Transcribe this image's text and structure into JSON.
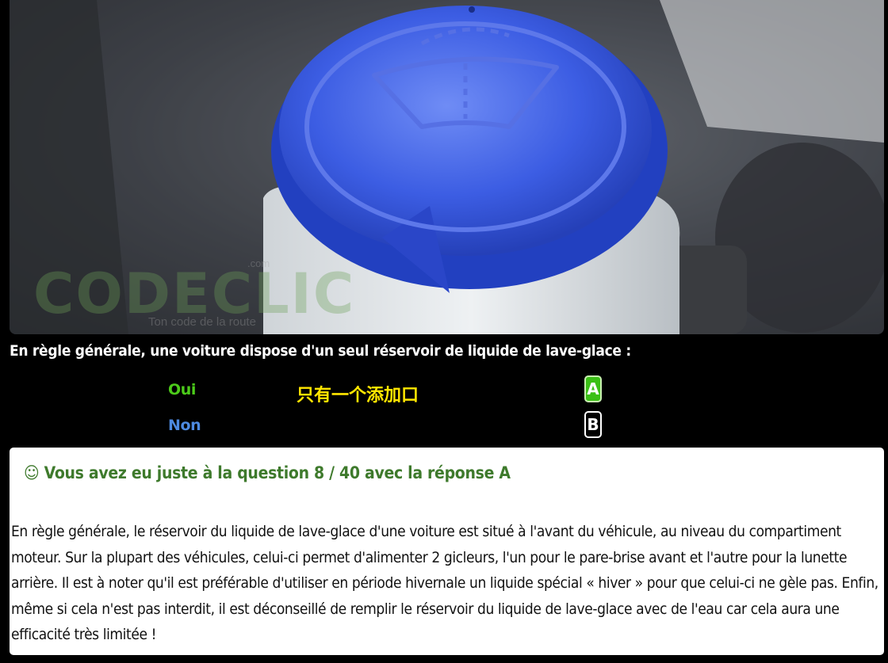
{
  "question": {
    "text": "En règle générale, une voiture dispose d'un seul réservoir de liquide de lave-glace :",
    "answers": [
      {
        "label": "Oui",
        "letter": "A",
        "state": "correct"
      },
      {
        "label": "Non",
        "letter": "B",
        "state": "neutral"
      }
    ],
    "note": "只有一个添加口"
  },
  "watermark": {
    "brand": "CODECLIC",
    "tld": ".com",
    "tagline": "Ton code de la route"
  },
  "result": {
    "title": "☺ Vous avez eu juste à la question 8 / 40 avec la réponse A",
    "explanation": "En règle générale, le réservoir du liquide de lave-glace d'une voiture est situé à l'avant du véhicule, au niveau du compartiment moteur. Sur la plupart des véhicules, celui-ci permet d'alimenter 2 gicleurs, l'un pour le pare-brise avant et l'autre pour la lunette arrière. Il est à noter qu'il est préférable d'utiliser en période hivernale un liquide spécial « hiver » pour que celui-ci ne gèle pas. Enfin, même si cela n'est pas interdit, il est déconseillé de remplir le réservoir du liquide de lave-glace avec de l'eau car cela aura une efficacité très limitée !"
  },
  "colors": {
    "correct": "#3bc016",
    "answer_a_text": "#4ccb1a",
    "answer_b_text": "#4d8ae0",
    "note": "#ffe600",
    "result_title": "#3e7a2c",
    "cap_blue": "#2f4fd6"
  }
}
